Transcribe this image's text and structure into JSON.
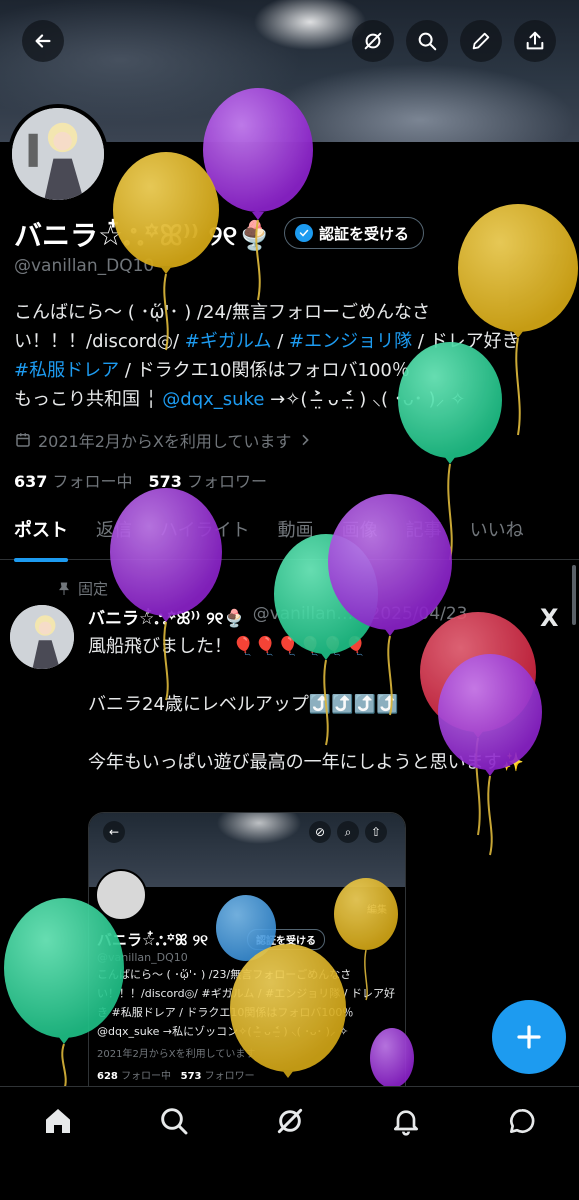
{
  "profile": {
    "name": "バニラ☆໋𖡺꙳ꕤ⁾⁾ ୨୧🍨",
    "verify_label": "認証を受ける",
    "handle": "@vanillan_DQ10",
    "bio_line1_a": "こんばにら〜 ( ･ᾥ'･ ) /24/無言フォローごめんなさい！！！/discord◎/ ",
    "bio_tag1": "#ギガルム",
    "bio_sep1": " / ",
    "bio_tag2": "#エンジョリ隊",
    "bio_after2": " / ドレア好き",
    "bio_tag3": "#私服ドレア",
    "bio_after3": " / ドラクエ10関係はフォロバ100％",
    "bio_line4_a": "もっこり共和国 ╎ ",
    "bio_mention": "@dqx_suke",
    "bio_line4_b": " →✧( ˃̶̤̀ ᴗ ˂̶̤́ ) ⸜( ･ᴗ･ )⸝ ✧",
    "joined": "2021年2月からXを利用しています",
    "following_count": "637",
    "following_label": "フォロー中",
    "followers_count": "573",
    "followers_label": "フォロワー"
  },
  "tabs": [
    "ポスト",
    "返信",
    "ハイライト",
    "動画",
    "画像",
    "記事",
    "いいね"
  ],
  "post": {
    "pinned_label": "固定",
    "author": "バニラ☆໋𖡺꙳ꕤ⁾⁾ ୨୧🍨",
    "meta": "@vanillan… · 2025/04/23",
    "x_label": "X",
    "line1": "風船飛びました！🎈🎈🎈🎈🎈🎈",
    "line2": "バニラ24歳にレベルアップ⤴️⤴️⤴️⤴️",
    "line3": "今年もいっぱい遊び最高の一年にしようと思います✨"
  },
  "embed": {
    "name": "バニラ☆໋𖡺꙳ꕤ ୨୧",
    "verify_label": "認証を受ける",
    "handle": "@vanillan_DQ10",
    "edit_label": "編集",
    "bio": "こんばにら〜 ( ･ᾥ'･ ) /23/無言フォローごめんなさい！！！/discord◎/ #ギガルム / #エンジョリ隊 / ドレア好き #私服ドレア / ドラクエ10関係はフォロバ100％ @dqx_suke →私にゾッコン✧( ˃̶̤̀ ᴗ ˂̶̤́ ) ⸜( ･ᴗ･ )⸝ ✧",
    "joined": "2021年2月からXを利用しています",
    "following_count": "628",
    "following_label": "フォロー中",
    "followers_count": "573",
    "followers_label": "フォロワー"
  },
  "colors": {
    "accent": "#1d9bf0",
    "balloon_purple": "#9b2fd6",
    "balloon_yellow": "#e0b521",
    "balloon_green": "#2fd39a",
    "balloon_red": "#e0304a"
  },
  "icons": [
    "back-arrow-icon",
    "grok-icon",
    "search-icon",
    "edit-icon",
    "share-icon",
    "calendar-icon",
    "chevron-right-icon",
    "pin-icon",
    "x-logo-icon",
    "plus-icon",
    "home-icon",
    "explore-icon",
    "grok-nav-icon",
    "bell-icon",
    "messages-icon"
  ]
}
